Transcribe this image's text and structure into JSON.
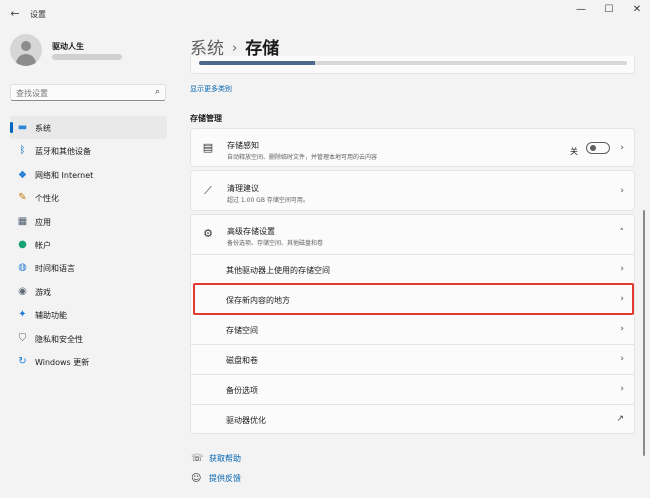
{
  "app": {
    "title": "设置",
    "back_icon": "back-arrow-icon"
  },
  "window_controls": {
    "minimize": "—",
    "maximize": "☐",
    "close": "✕"
  },
  "profile": {
    "name": "驱动人生"
  },
  "search": {
    "placeholder": "查找设置",
    "icon": "search-icon"
  },
  "sidebar": {
    "items": [
      {
        "label": "系统",
        "icon": "monitor-icon",
        "glyph": "▬",
        "color": "#2b88d8",
        "active": true
      },
      {
        "label": "蓝牙和其他设备",
        "icon": "bluetooth-icon",
        "glyph": "ᛒ",
        "color": "#0067c0",
        "active": false
      },
      {
        "label": "网络和 Internet",
        "icon": "wifi-icon",
        "glyph": "◆",
        "color": "#2f7fd6",
        "active": false
      },
      {
        "label": "个性化",
        "icon": "paint-brush-icon",
        "glyph": "✎",
        "color": "#c4750a",
        "active": false
      },
      {
        "label": "应用",
        "icon": "apps-grid-icon",
        "glyph": "▦",
        "color": "#4a5b6e",
        "active": false
      },
      {
        "label": "帐户",
        "icon": "person-icon",
        "glyph": "●",
        "color": "#1aa176",
        "active": false
      },
      {
        "label": "时间和语言",
        "icon": "globe-clock-icon",
        "glyph": "◍",
        "color": "#2f7fd6",
        "active": false
      },
      {
        "label": "游戏",
        "icon": "gamepad-icon",
        "glyph": "◉",
        "color": "#5f6b78",
        "active": false
      },
      {
        "label": "辅助功能",
        "icon": "accessibility-icon",
        "glyph": "✦",
        "color": "#1a7ad6",
        "active": false
      },
      {
        "label": "隐私和安全性",
        "icon": "shield-icon",
        "glyph": "⛉",
        "color": "#5f6b78",
        "active": false
      },
      {
        "label": "Windows 更新",
        "icon": "refresh-icon",
        "glyph": "↻",
        "color": "#1a7ad6",
        "active": false
      }
    ]
  },
  "breadcrumb": {
    "parent": "系统",
    "separator": "›",
    "current": "存储"
  },
  "usage_bar": {
    "fill_percent": 27
  },
  "show_more_categories": "显示更多类别",
  "storage_management": {
    "title": "存储管理",
    "storage_sense": {
      "title": "存储感知",
      "subtitle": "自动释放空间、删除临时文件，并管理本地可用的云内容",
      "icon": "storage-drive-icon",
      "toggle_label": "关",
      "toggle_on": false
    },
    "cleanup": {
      "title": "清理建议",
      "subtitle": "超过 1.00 GB 存储空间可用。",
      "icon": "broom-icon"
    },
    "advanced": {
      "title": "高级存储设置",
      "subtitle": "备份选项、存储空间、其他磁盘和卷",
      "icon": "gear-icon",
      "items": [
        {
          "label": "其他驱动器上使用的存储空间",
          "action": "chevron-right-icon"
        },
        {
          "label": "保存新内容的地方",
          "action": "chevron-right-icon",
          "highlighted": true
        },
        {
          "label": "存储空间",
          "action": "chevron-right-icon"
        },
        {
          "label": "磁盘和卷",
          "action": "chevron-right-icon"
        },
        {
          "label": "备份选项",
          "action": "chevron-right-icon"
        },
        {
          "label": "驱动器优化",
          "action": "external-link-icon"
        }
      ]
    }
  },
  "footer": {
    "help": "获取帮助",
    "feedback": "提供反馈"
  },
  "colors": {
    "accent": "#0067c0",
    "highlight_border": "#e23a2e",
    "link": "#0063b1"
  }
}
